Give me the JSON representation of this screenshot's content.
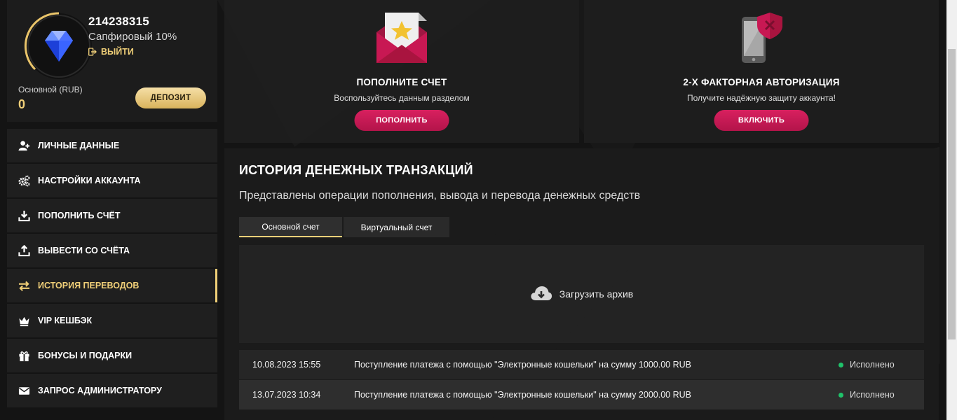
{
  "profile": {
    "user_id": "214238315",
    "level": "Сапфировый 10%",
    "logout_label": "ВЫЙТИ",
    "balance_label": "Основной (RUB)",
    "balance_value": "0",
    "deposit_label": "ДЕПОЗИТ",
    "level_progress_percent": 10
  },
  "menu": {
    "items": [
      {
        "label": "ЛИЧНЫЕ ДАННЫЕ",
        "icon": "user-plus-icon"
      },
      {
        "label": "НАСТРОЙКИ АККАУНТА",
        "icon": "gears-icon"
      },
      {
        "label": "ПОПОЛНИТЬ СЧЁТ",
        "icon": "download-icon"
      },
      {
        "label": "ВЫВЕСТИ СО СЧЁТА",
        "icon": "upload-icon"
      },
      {
        "label": "ИСТОРИЯ ПЕРЕВОДОВ",
        "icon": "exchange-icon",
        "active": true
      },
      {
        "label": "VIP КЕШБЭК",
        "icon": "crown-icon"
      },
      {
        "label": "БОНУСЫ И ПОДАРКИ",
        "icon": "gift-icon"
      },
      {
        "label": "ЗАПРОС АДМИНИСТРАТОРУ",
        "icon": "envelope-icon"
      }
    ]
  },
  "cards": {
    "deposit": {
      "title": "ПОПОЛНИТЕ СЧЕТ",
      "subtitle": "Воспользуйтесь данным разделом",
      "button": "ПОПОЛНИТЬ",
      "icon": "envelope-star-icon"
    },
    "twofa": {
      "title": "2-Х ФАКТОРНАЯ АВТОРИЗАЦИЯ",
      "subtitle": "Получите надёжную защиту аккаунта!",
      "button": "ВКЛЮЧИТЬ",
      "icon": "phone-shield-icon"
    }
  },
  "history": {
    "title": "ИСТОРИЯ ДЕНЕЖНЫХ ТРАНЗАКЦИЙ",
    "subtitle": "Представлены операции пополнения, вывода и перевода денежных средств",
    "tabs": [
      "Основной счет",
      "Виртуальный счет"
    ],
    "active_tab": 0,
    "archive_label": "Загрузить архив",
    "transactions": [
      {
        "date": "10.08.2023 15:55",
        "description": "Поступление платежа с помощью \"Электронные кошельки\" на сумму 1000.00 RUB",
        "status": "Исполнено"
      },
      {
        "date": "13.07.2023 10:34",
        "description": "Поступление платежа с помощью \"Электронные кошельки\" на сумму 2000.00 RUB",
        "status": "Исполнено"
      }
    ]
  },
  "colors": {
    "accent_gold": "#f0cf78",
    "accent_pink": "#c81853",
    "status_success": "#1fc36a",
    "background": "#141414"
  }
}
